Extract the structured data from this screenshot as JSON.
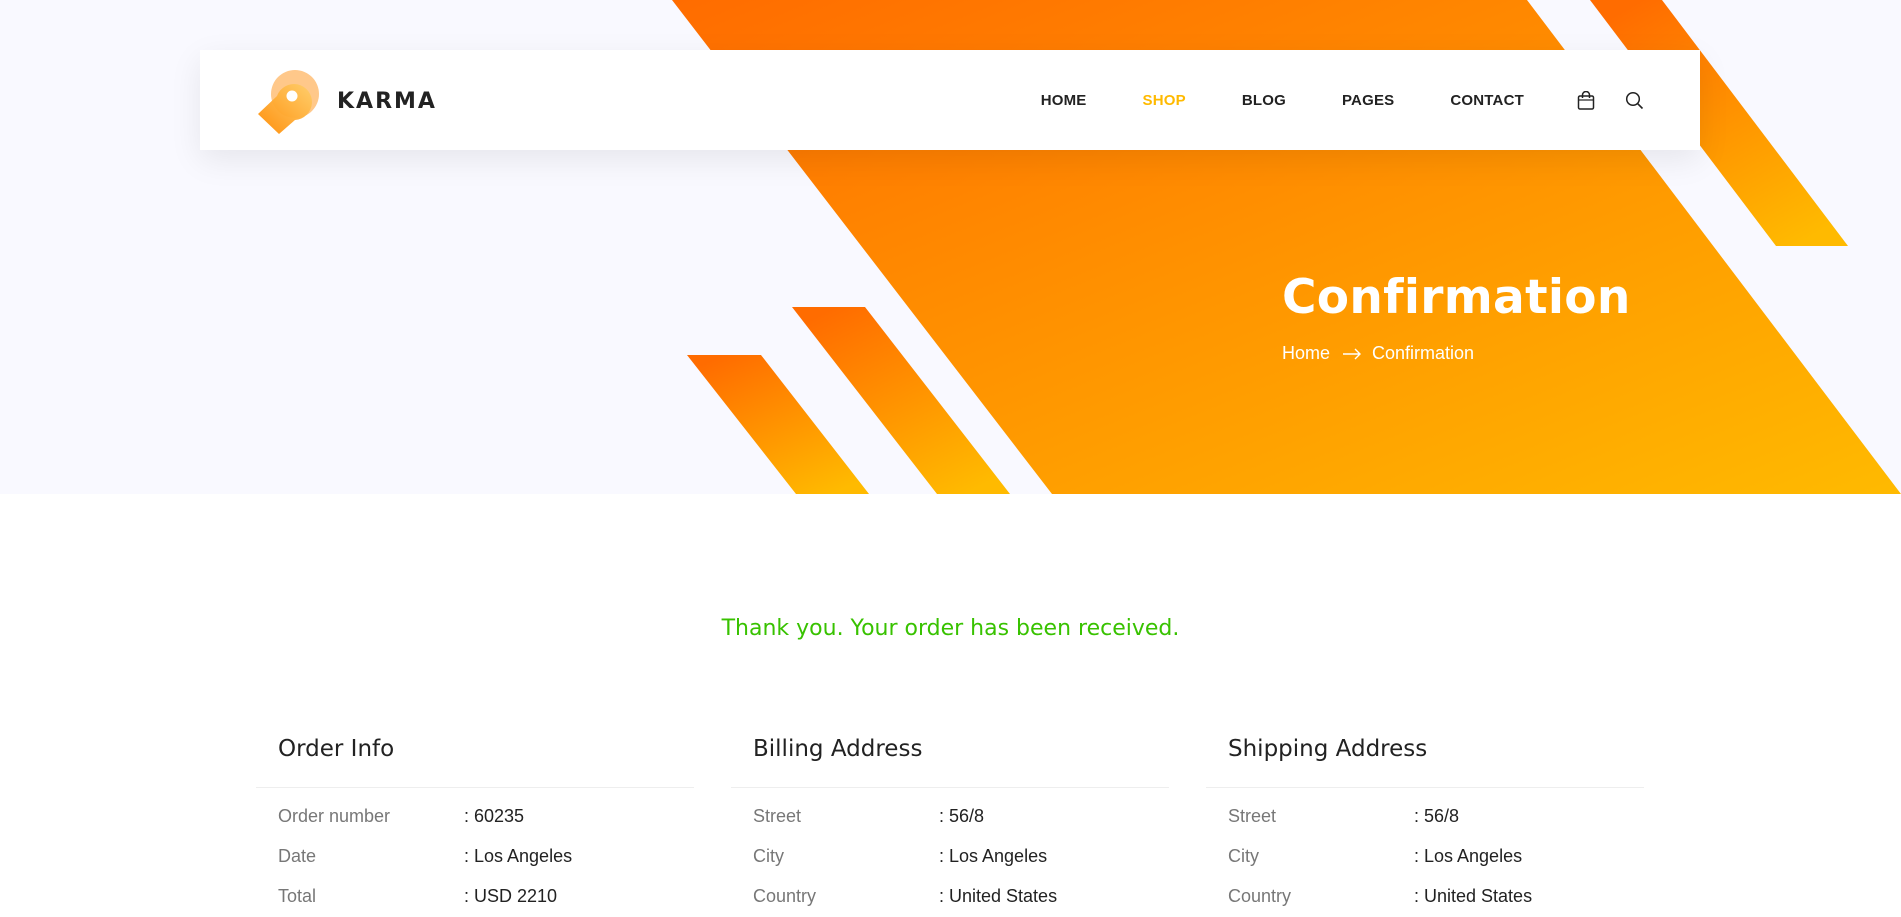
{
  "brand": {
    "name": "KARMA"
  },
  "nav": {
    "items": [
      {
        "label": "HOME"
      },
      {
        "label": "SHOP",
        "active": true
      },
      {
        "label": "BLOG"
      },
      {
        "label": "PAGES"
      },
      {
        "label": "CONTACT"
      }
    ],
    "icons": [
      "shopping-bag-icon",
      "search-icon"
    ],
    "active_color": "#ffba00"
  },
  "banner": {
    "title": "Confirmation",
    "breadcrumb": {
      "home": "Home",
      "current": "Confirmation"
    },
    "gradient": [
      "#ff6c00",
      "#ffba00"
    ]
  },
  "confirmation": {
    "message": "Thank you. Your order has been received.",
    "message_color": "#38c200",
    "columns": [
      {
        "title": "Order Info",
        "rows": [
          {
            "label": "Order number",
            "value": ": 60235"
          },
          {
            "label": "Date",
            "value": ": Los Angeles"
          },
          {
            "label": "Total",
            "value": ": USD 2210"
          }
        ]
      },
      {
        "title": "Billing Address",
        "rows": [
          {
            "label": "Street",
            "value": ": 56/8"
          },
          {
            "label": "City",
            "value": ": Los Angeles"
          },
          {
            "label": "Country",
            "value": ": United States"
          }
        ]
      },
      {
        "title": "Shipping Address",
        "rows": [
          {
            "label": "Street",
            "value": ": 56/8"
          },
          {
            "label": "City",
            "value": ": Los Angeles"
          },
          {
            "label": "Country",
            "value": ": United States"
          }
        ]
      }
    ]
  }
}
